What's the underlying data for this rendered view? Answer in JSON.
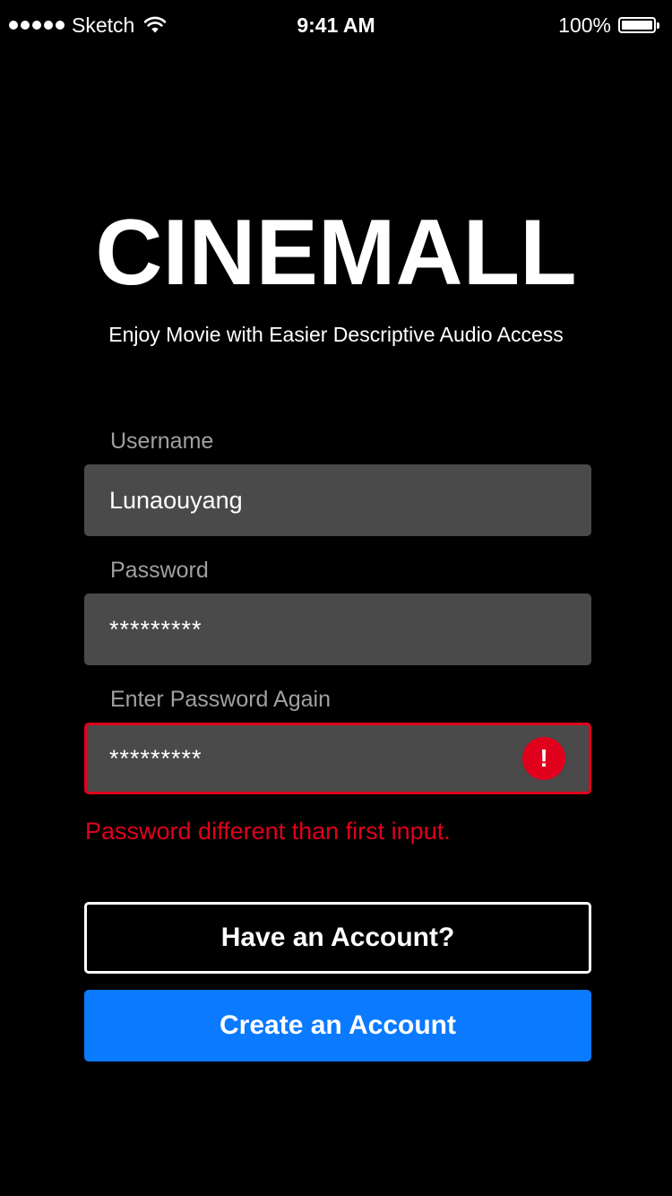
{
  "status_bar": {
    "carrier": "Sketch",
    "time": "9:41 AM",
    "battery": "100%",
    "battery_level": 1.0,
    "signal_bars": 5,
    "icons": [
      "signal-dots-icon",
      "wifi-icon",
      "battery-icon"
    ]
  },
  "brand": {
    "logo_text": "CINEMALL",
    "tagline": "Enjoy Movie with Easier Descriptive Audio Access"
  },
  "form": {
    "username": {
      "label": "Username",
      "value": "Lunaouyang"
    },
    "password": {
      "label": "Password",
      "value": "*********"
    },
    "password_confirm": {
      "label": "Enter Password Again",
      "value": "*********",
      "error_icon": "!",
      "error_icon_name": "error-icon"
    },
    "error_message": "Password different than first input."
  },
  "buttons": {
    "have_account": "Have an Account?",
    "create_account": "Create an Account"
  },
  "colors": {
    "background": "#000000",
    "field_background": "#4a4a4a",
    "label": "#a0a0a0",
    "error": "#e0001c",
    "primary": "#0a7aff",
    "text": "#ffffff"
  }
}
